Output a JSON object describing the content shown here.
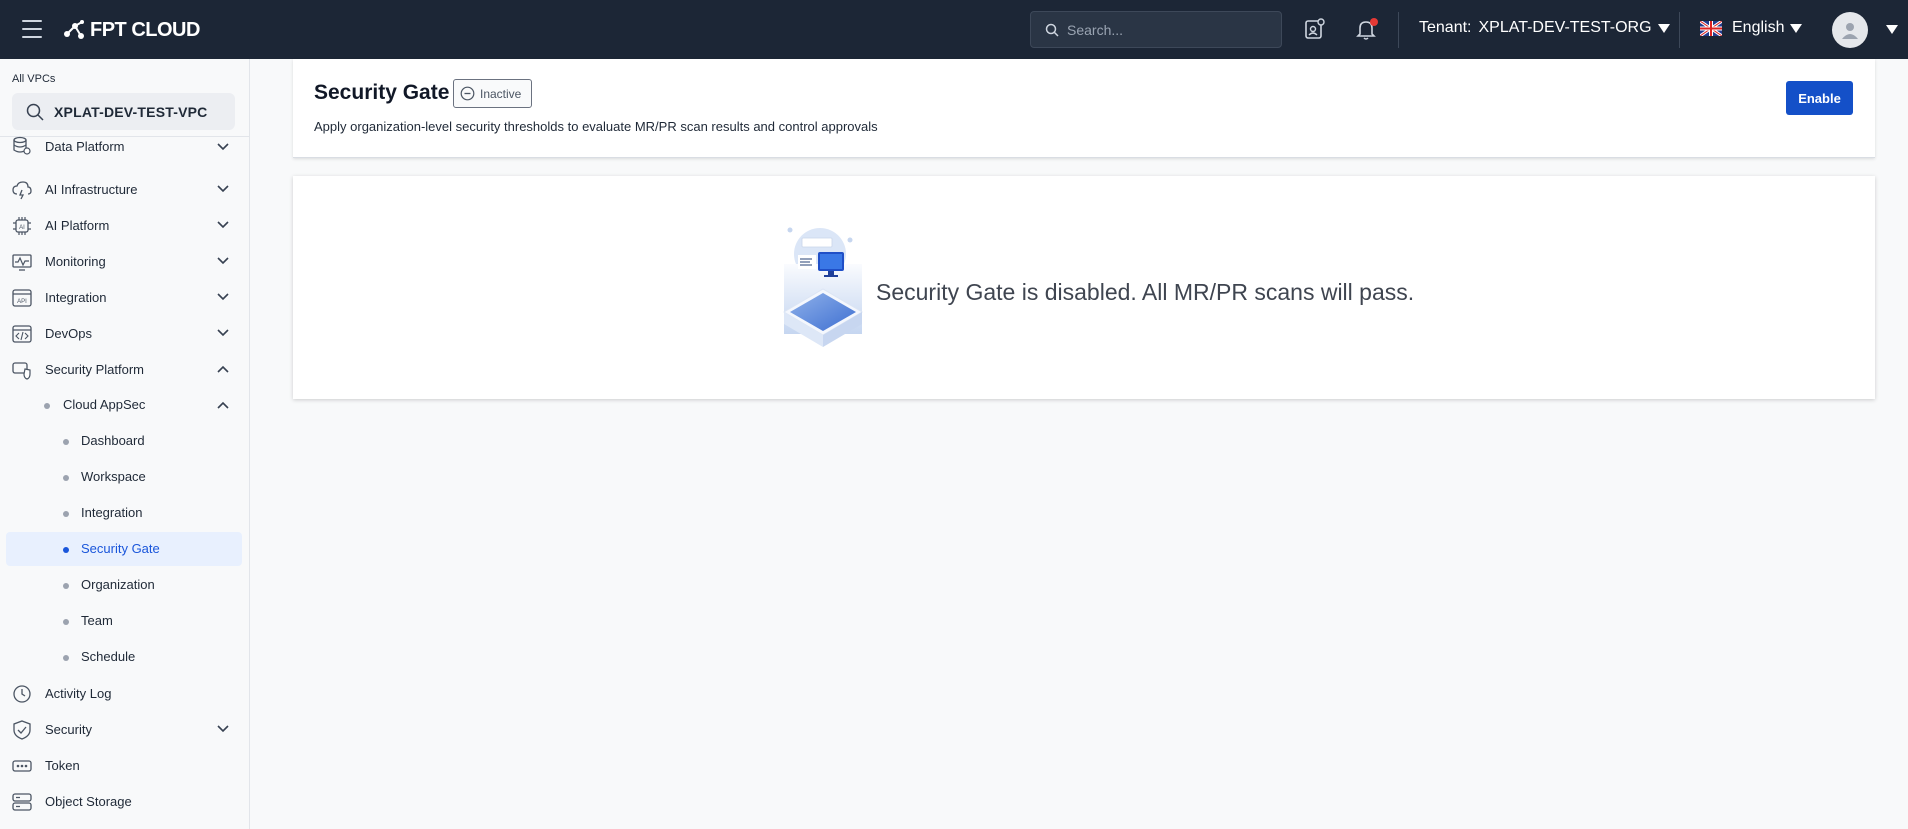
{
  "header": {
    "brand": "FPT CLOUD",
    "search_placeholder": "Search...",
    "tenant_label": "Tenant:",
    "tenant_value": "XPLAT-DEV-TEST-ORG",
    "language": "English"
  },
  "sidebar": {
    "vpc_label": "All VPCs",
    "vpc_value": "XPLAT-DEV-TEST-VPC",
    "items": [
      {
        "label": "Data Platform",
        "icon": "database-icon",
        "expanded": false
      },
      {
        "label": "AI Infrastructure",
        "icon": "cloud-lightning-icon",
        "expanded": false
      },
      {
        "label": "AI Platform",
        "icon": "ai-chip-icon",
        "expanded": false
      },
      {
        "label": "Monitoring",
        "icon": "monitor-pulse-icon",
        "expanded": false
      },
      {
        "label": "Integration",
        "icon": "api-icon",
        "expanded": false
      },
      {
        "label": "DevOps",
        "icon": "code-window-icon",
        "expanded": false
      },
      {
        "label": "Security Platform",
        "icon": "shield-link-icon",
        "expanded": true
      },
      {
        "label": "Cloud AppSec",
        "expanded": true
      },
      {
        "label": "Dashboard"
      },
      {
        "label": "Workspace"
      },
      {
        "label": "Integration"
      },
      {
        "label": "Security Gate",
        "active": true
      },
      {
        "label": "Organization"
      },
      {
        "label": "Team"
      },
      {
        "label": "Schedule"
      },
      {
        "label": "Activity Log",
        "icon": "clock-icon"
      },
      {
        "label": "Security",
        "icon": "shield-check-icon",
        "expanded": false
      },
      {
        "label": "Token",
        "icon": "token-icon"
      },
      {
        "label": "Object Storage",
        "icon": "storage-icon"
      }
    ]
  },
  "page": {
    "title": "Security Gate",
    "status_badge": "Inactive",
    "description": "Apply organization-level security thresholds to evaluate MR/PR scan results and control approvals",
    "enable_button": "Enable",
    "empty_state_text": "Security Gate is disabled. All MR/PR scans will pass."
  },
  "colors": {
    "topbar_bg": "#1c2636",
    "primary": "#1450c8",
    "active_nav_bg": "#e8f0fe",
    "notification_dot": "#e53935"
  }
}
